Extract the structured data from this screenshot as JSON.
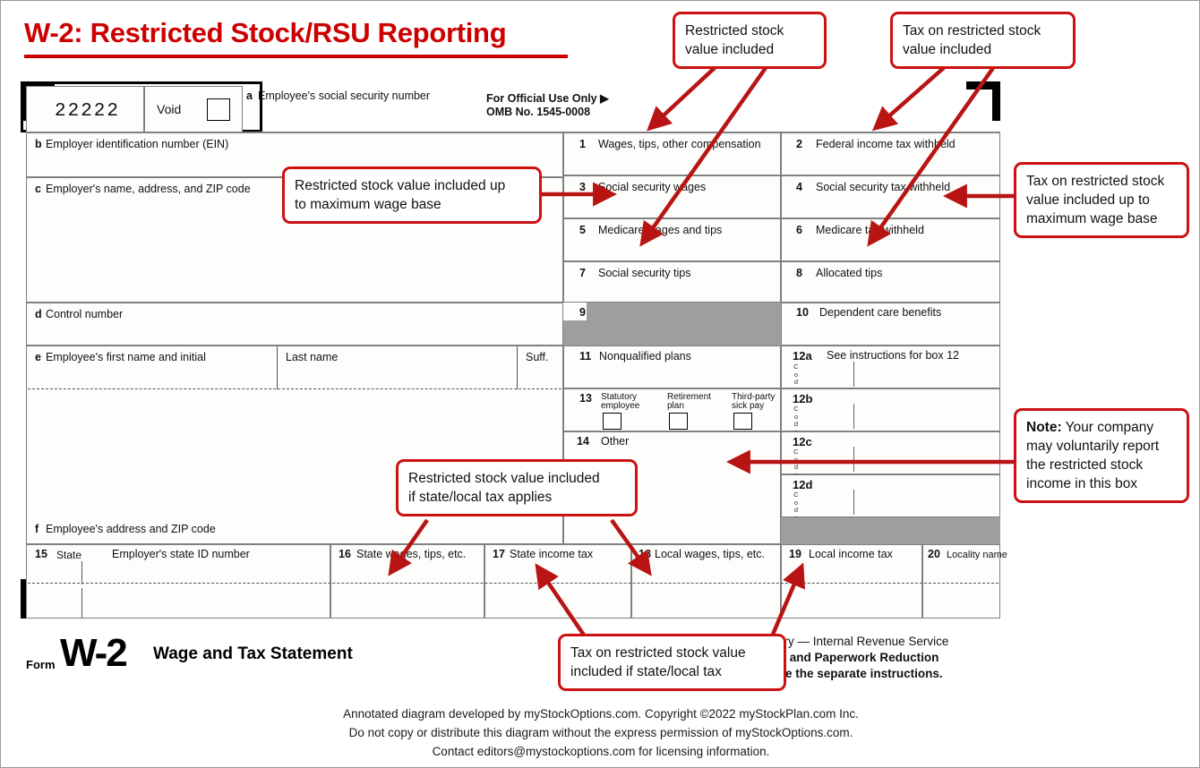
{
  "title": "W-2: Restricted Stock/RSU Reporting",
  "colors": {
    "accent_red": "#cc0000",
    "callout_border": "#cc1111",
    "shaded_gray": "#9e9e9e"
  },
  "form": {
    "control_number_value": "22222",
    "void_label": "Void",
    "box_a": "Employee's social security number",
    "official_use": "For Official Use Only ▶",
    "omb": "OMB No. 1545-0008",
    "box_b": "Employer identification number (EIN)",
    "box_c": "Employer's name, address, and ZIP code",
    "box_d": "Control number",
    "box_e": "Employee's first name and initial",
    "box_e_last": "Last name",
    "box_e_suff": "Suff.",
    "box_f": "Employee's address and ZIP code",
    "box_1": "Wages, tips, other compensation",
    "box_2": "Federal income tax withheld",
    "box_3": "Social security wages",
    "box_4": "Social security tax withheld",
    "box_5": "Medicare wages and tips",
    "box_6": "Medicare tax withheld",
    "box_7": "Social security tips",
    "box_8": "Allocated tips",
    "box_9": "",
    "box_10": "Dependent care benefits",
    "box_11": "Nonqualified plans",
    "box_12a": "See instructions for box 12",
    "box_12b": "",
    "box_12c": "",
    "box_12d": "",
    "code_label": "Code",
    "box_13": "",
    "box_13_opt1": "Statutory\nemployee",
    "box_13_opt1_l1": "Statutory",
    "box_13_opt1_l2": "employee",
    "box_13_opt2_l1": "Retirement",
    "box_13_opt2_l2": "plan",
    "box_13_opt3_l1": "Third-party",
    "box_13_opt3_l2": "sick pay",
    "box_14": "Other",
    "box_15": "State",
    "box_15_extra": "Employer's state ID number",
    "box_16": "State wages, tips, etc.",
    "box_17": "State income tax",
    "box_18": "Local wages, tips, etc.",
    "box_19": "Local income tax",
    "box_20": "Locality name",
    "numbers": {
      "n1": "1",
      "n2": "2",
      "n3": "3",
      "n4": "4",
      "n5": "5",
      "n6": "6",
      "n7": "7",
      "n8": "8",
      "n9": "9",
      "n10": "10",
      "n11": "11",
      "n12a": "12a",
      "n12b": "12b",
      "n12c": "12c",
      "n12d": "12d",
      "n13": "13",
      "n14": "14",
      "n15": "15",
      "n16": "16",
      "n17": "17",
      "n18": "18",
      "n19": "19",
      "n20": "20",
      "la": "a",
      "lb": "b",
      "lc": "c",
      "ld": "d",
      "le": "e",
      "lf": "f"
    },
    "footer": {
      "form_word": "Form",
      "w2": "W-2",
      "statement": "Wage and Tax Statement",
      "dept_line": "e Treasury — Internal Revenue Service",
      "privacy_line1": "vacy Act and Paperwork Reduction",
      "privacy_line2": "otice, see the separate instructions."
    }
  },
  "callouts": {
    "c1": {
      "line1": "Restricted stock",
      "line2": "value included"
    },
    "c2": {
      "line1": "Tax on restricted stock",
      "line2": "value included"
    },
    "c3": {
      "line1": "Restricted stock value included up",
      "line2": "to maximum wage base"
    },
    "c4": {
      "line1": "Tax on restricted stock",
      "line2": "value included up to",
      "line3": "maximum wage base"
    },
    "c5": {
      "bold": "Note:",
      "line1": " Your company",
      "line2": "may voluntarily report",
      "line3": "the restricted stock",
      "line4": "income in this box"
    },
    "c6": {
      "line1": "Restricted stock value included",
      "line2": "if state/local tax applies"
    },
    "c7": {
      "line1": "Tax on restricted stock value",
      "line2": "included if state/local tax"
    }
  },
  "credits": {
    "line1": "Annotated diagram developed by myStockOptions.com. Copyright ©2022 myStockPlan.com Inc.",
    "line2": "Do not copy or distribute this diagram without the express permission of myStockOptions.com.",
    "line3": "Contact editors@mystockoptions.com for licensing information."
  }
}
